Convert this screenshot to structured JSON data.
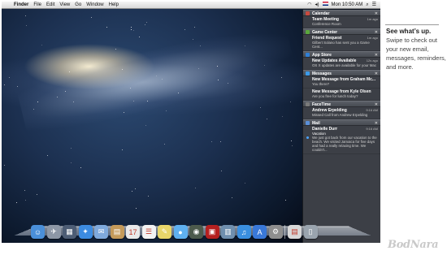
{
  "menubar": {
    "apple": "",
    "items": [
      "Finder",
      "File",
      "Edit",
      "View",
      "Go",
      "Window",
      "Help"
    ],
    "status_icons": [
      "wifi-icon",
      "volume-icon",
      "flag-icon"
    ],
    "clock": "Mon 10:50 AM"
  },
  "notification_center": {
    "sections": [
      {
        "app": "Calendar",
        "icon": "calendar-icon",
        "color": "#c94a3f",
        "items": [
          {
            "title": "Team Meeting",
            "ago": "1m ago",
            "body": "Conference Room"
          }
        ]
      },
      {
        "app": "Game Center",
        "icon": "game-center-icon",
        "color": "#5aa83c",
        "items": [
          {
            "title": "Friend Request",
            "ago": "1m ago",
            "body": "Gilbert Solano has sent you a Game Cent..."
          }
        ]
      },
      {
        "app": "App Store",
        "icon": "app-store-icon",
        "color": "#2f7fd6",
        "items": [
          {
            "title": "New Updates Available",
            "ago": "12s ago",
            "body": "OS X updates are available for your Mac"
          }
        ]
      },
      {
        "app": "Messages",
        "icon": "messages-icon",
        "color": "#3b9ae8",
        "items": [
          {
            "title": "New Message from Graham Mc...",
            "ago": "",
            "body": "You there?"
          },
          {
            "title": "New Message from Kyle Olsen",
            "ago": "",
            "body": "Are you free for lunch today?"
          }
        ]
      },
      {
        "app": "FaceTime",
        "icon": "facetime-icon",
        "color": "#7a7a7a",
        "items": [
          {
            "title": "Andrew Erpelding",
            "ago": "9:16 AM",
            "body": "Missed Call from Andrew Erpelding"
          }
        ]
      },
      {
        "app": "Mail",
        "icon": "mail-icon",
        "color": "#5a8fd8",
        "items": [
          {
            "title": "Danielle Durr",
            "ago": "9:16 AM",
            "subtitle": "Vacation",
            "body": "We just got back from our vacation to the beach. We visited Jamaica for five days and had a really relaxing time. We couldn't...",
            "unread": true
          }
        ]
      }
    ]
  },
  "dock": {
    "apps": [
      {
        "name": "finder-icon",
        "glyph": "☺",
        "color": "#4a8fd9"
      },
      {
        "name": "launchpad-icon",
        "glyph": "✈",
        "color": "#8d97a6"
      },
      {
        "name": "mission-control-icon",
        "glyph": "▦",
        "color": "#4d5d75"
      },
      {
        "name": "safari-icon",
        "glyph": "✦",
        "color": "#3c8be0"
      },
      {
        "name": "mail-app-icon",
        "glyph": "✉",
        "color": "#7fa9dc"
      },
      {
        "name": "contacts-icon",
        "glyph": "▤",
        "color": "#c49a5a"
      },
      {
        "name": "calendar-app-icon",
        "glyph": "17",
        "color": "#e9e9e9"
      },
      {
        "name": "reminders-icon",
        "glyph": "☰",
        "color": "#f2f2f2"
      },
      {
        "name": "notes-icon",
        "glyph": "✎",
        "color": "#e8d66a"
      },
      {
        "name": "messages-app-icon",
        "glyph": "●",
        "color": "#5fb0f0"
      },
      {
        "name": "facetime-app-icon",
        "glyph": "◉",
        "color": "#4c5a4c"
      },
      {
        "name": "photo-booth-icon",
        "glyph": "▣",
        "color": "#b52020"
      },
      {
        "name": "iphoto-icon",
        "glyph": "▥",
        "color": "#6f8fae"
      },
      {
        "name": "itunes-icon",
        "glyph": "♫",
        "color": "#3a8fe0"
      },
      {
        "name": "app-store-app-icon",
        "glyph": "A",
        "color": "#3978d8"
      },
      {
        "name": "system-preferences-icon",
        "glyph": "⚙",
        "color": "#8e8e8e"
      }
    ],
    "stacks": [
      {
        "name": "documents-icon",
        "glyph": "▤",
        "color": "#d8d8d8"
      },
      {
        "name": "trash-icon",
        "glyph": "▯",
        "color": "#9aa4ae"
      }
    ]
  },
  "caption": {
    "title": "See what’s up.",
    "body": "Swipe to check out your new email, messages, reminders, and more."
  },
  "watermark": "BodNara"
}
